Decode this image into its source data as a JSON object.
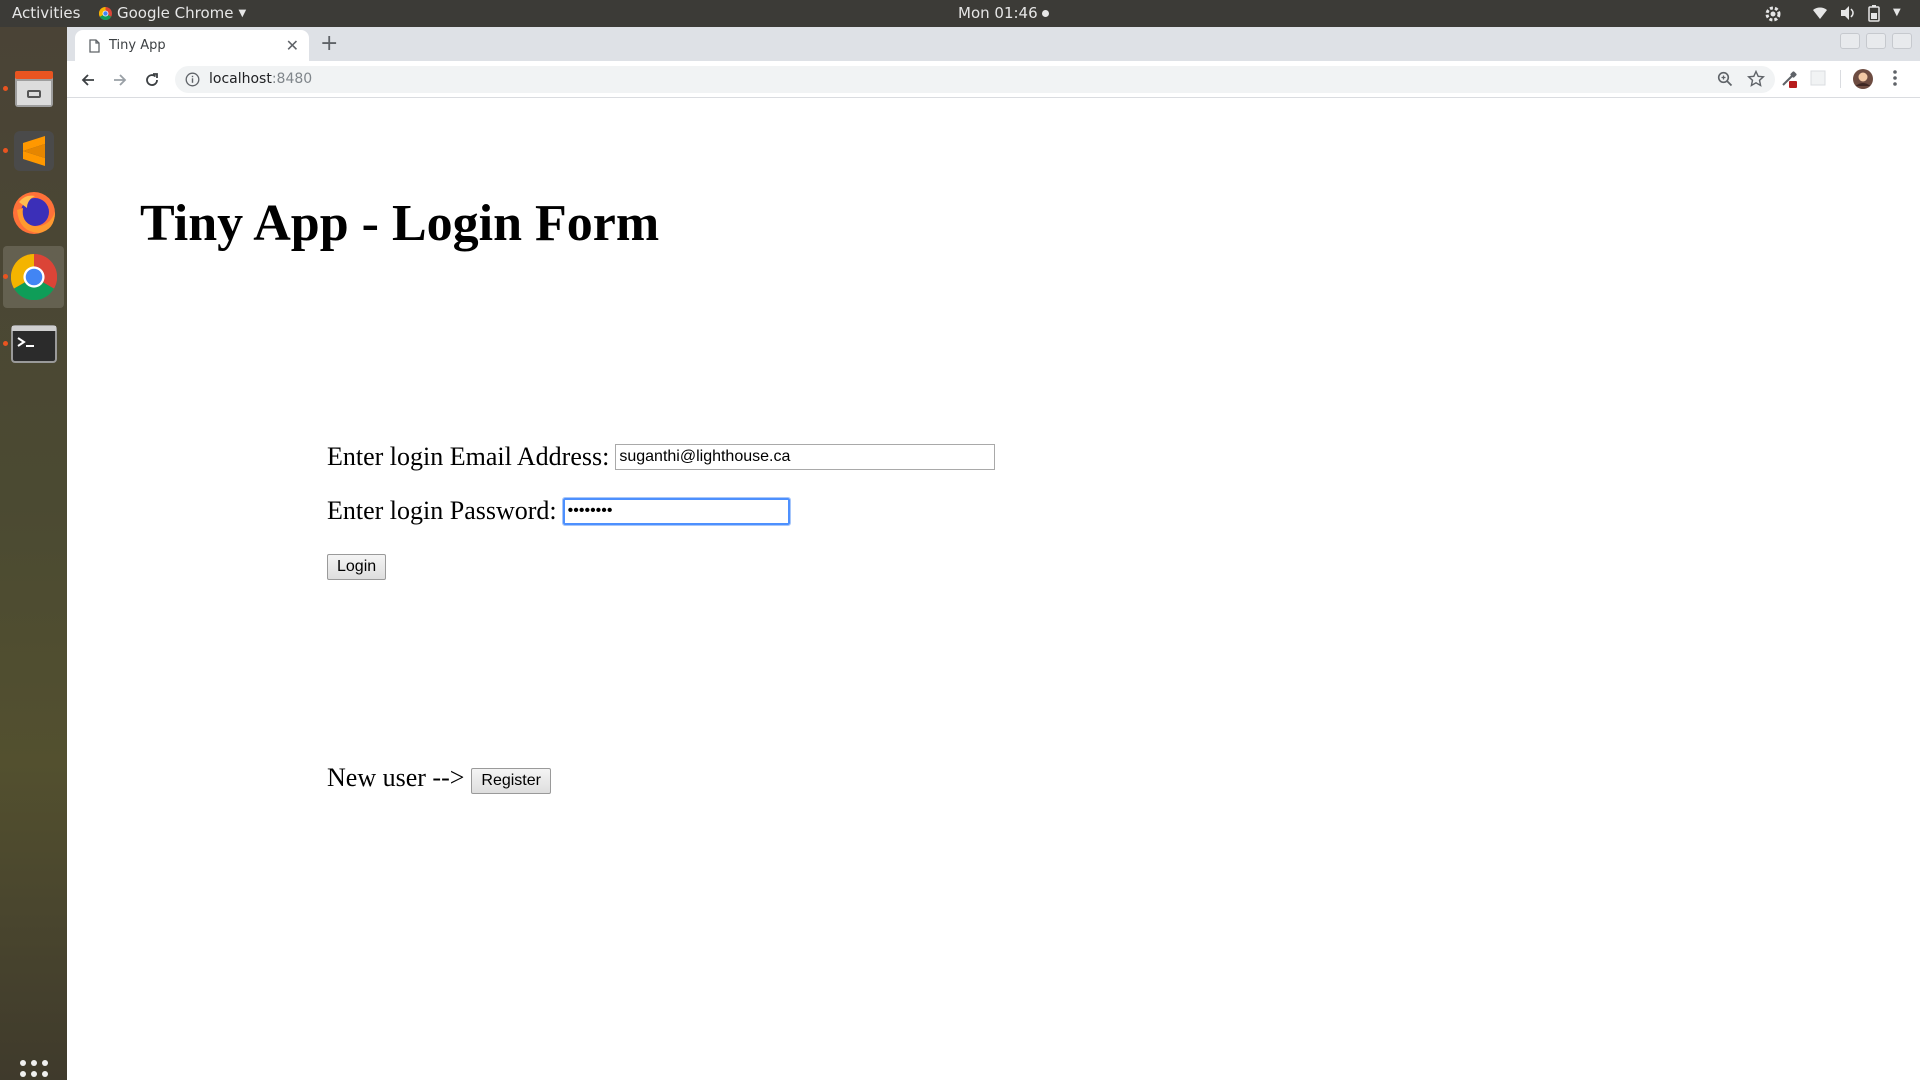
{
  "topbar": {
    "activities": "Activities",
    "app_name": "Google Chrome",
    "clock": "Mon 01:46"
  },
  "dock": {
    "items": [
      "files-icon",
      "sublime-text-icon",
      "firefox-icon",
      "chrome-icon",
      "terminal-icon"
    ],
    "show_apps": "apps-grid-icon"
  },
  "browser": {
    "tab_title": "Tiny App",
    "new_tab": "+",
    "url_host": "localhost",
    "url_port": ":8480"
  },
  "page": {
    "title": "Tiny App - Login Form",
    "email_label": "Enter login Email Address:",
    "email_value": "suganthi@lighthouse.ca",
    "password_label": "Enter login Password:",
    "password_value": "********",
    "login_button": "Login",
    "new_user_label": "New user -->",
    "register_button": "Register"
  },
  "colors": {
    "topbar_bg": "#3c3b37",
    "tabstrip_bg": "#dee1e6",
    "focus_blue": "#4d90fe",
    "ubuntu_orange": "#e95420"
  }
}
